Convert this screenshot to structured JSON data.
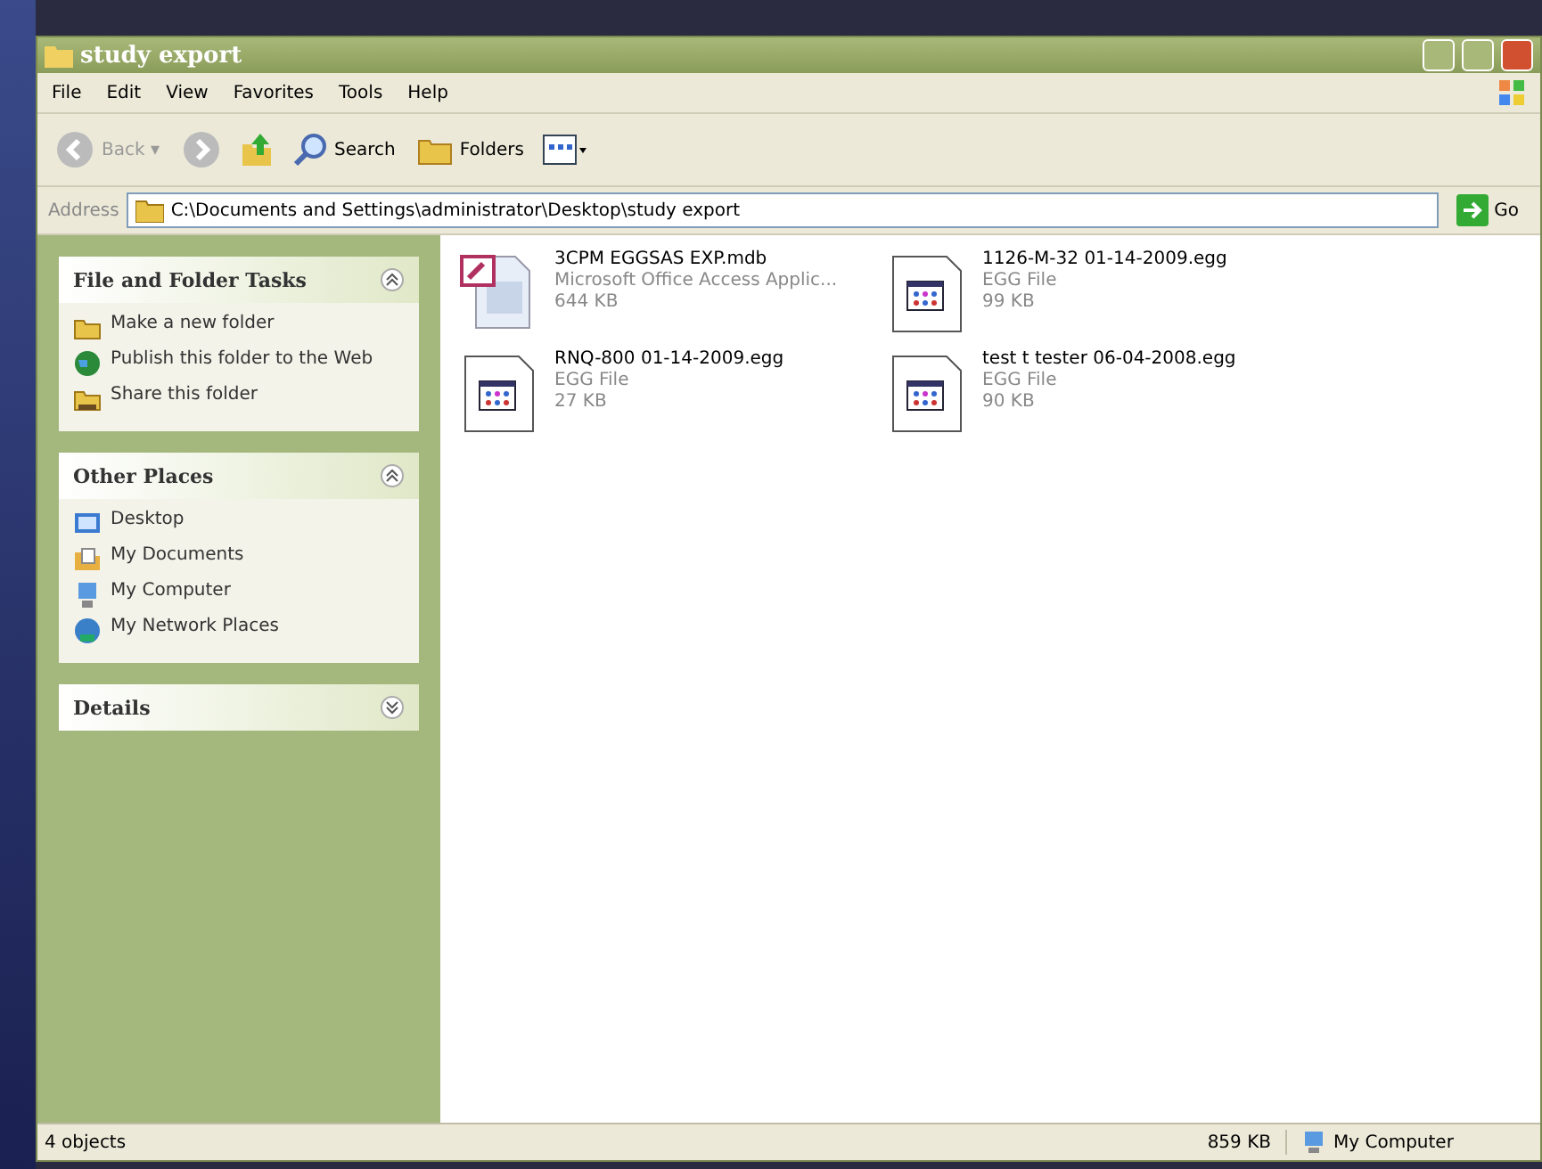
{
  "window": {
    "title": "study export"
  },
  "menu": [
    "File",
    "Edit",
    "View",
    "Favorites",
    "Tools",
    "Help"
  ],
  "toolbar": {
    "back": "Back",
    "back_dropdown": "▾",
    "search": "Search",
    "folders": "Folders"
  },
  "address": {
    "label": "Address",
    "value": "C:\\Documents and Settings\\administrator\\Desktop\\study export",
    "go": "Go"
  },
  "sidebar": [
    {
      "title": "File and Folder Tasks",
      "expanded": true,
      "items": [
        {
          "label": "Make a new folder",
          "kind": "folder"
        },
        {
          "label": "Publish this folder to the Web",
          "kind": "globe"
        },
        {
          "label": "Share this folder",
          "kind": "share"
        }
      ]
    },
    {
      "title": "Other Places",
      "expanded": true,
      "items": [
        {
          "label": "Desktop",
          "kind": "desktop"
        },
        {
          "label": "My Documents",
          "kind": "documents"
        },
        {
          "label": "My Computer",
          "kind": "computer"
        },
        {
          "label": "My Network Places",
          "kind": "network"
        }
      ]
    },
    {
      "title": "Details",
      "expanded": false
    }
  ],
  "files": [
    {
      "name": "3CPM EGGSAS EXP.mdb",
      "type": "Microsoft Office Access Applic...",
      "size": "644 KB",
      "kind": "mdb"
    },
    {
      "name": "1126-M-32 01-14-2009.egg",
      "type": "EGG File",
      "size": "99 KB",
      "kind": "egg"
    },
    {
      "name": "RNQ-800 01-14-2009.egg",
      "type": "EGG File",
      "size": "27 KB",
      "kind": "egg"
    },
    {
      "name": "test t tester 06-04-2008.egg",
      "type": "EGG File",
      "size": "90 KB",
      "kind": "egg"
    }
  ],
  "status_bar": {
    "objects": "4 objects",
    "size": "859 KB",
    "location": "My Computer"
  }
}
